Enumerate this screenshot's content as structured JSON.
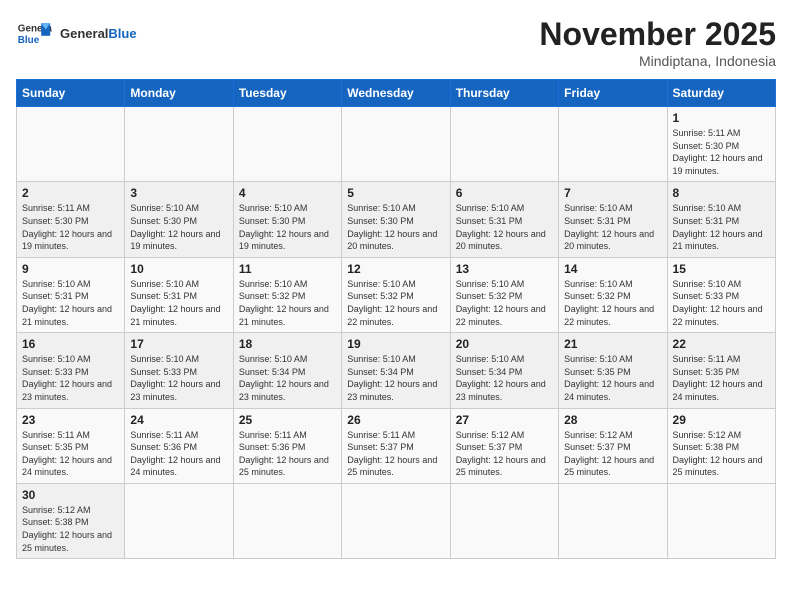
{
  "header": {
    "logo_text_general": "General",
    "logo_text_blue": "Blue",
    "title": "November 2025",
    "subtitle": "Mindiptana, Indonesia"
  },
  "weekdays": [
    "Sunday",
    "Monday",
    "Tuesday",
    "Wednesday",
    "Thursday",
    "Friday",
    "Saturday"
  ],
  "rows": [
    [
      {
        "day": "",
        "info": ""
      },
      {
        "day": "",
        "info": ""
      },
      {
        "day": "",
        "info": ""
      },
      {
        "day": "",
        "info": ""
      },
      {
        "day": "",
        "info": ""
      },
      {
        "day": "",
        "info": ""
      },
      {
        "day": "1",
        "info": "Sunrise: 5:11 AM\nSunset: 5:30 PM\nDaylight: 12 hours and 19 minutes."
      }
    ],
    [
      {
        "day": "2",
        "info": "Sunrise: 5:11 AM\nSunset: 5:30 PM\nDaylight: 12 hours and 19 minutes."
      },
      {
        "day": "3",
        "info": "Sunrise: 5:10 AM\nSunset: 5:30 PM\nDaylight: 12 hours and 19 minutes."
      },
      {
        "day": "4",
        "info": "Sunrise: 5:10 AM\nSunset: 5:30 PM\nDaylight: 12 hours and 19 minutes."
      },
      {
        "day": "5",
        "info": "Sunrise: 5:10 AM\nSunset: 5:30 PM\nDaylight: 12 hours and 20 minutes."
      },
      {
        "day": "6",
        "info": "Sunrise: 5:10 AM\nSunset: 5:31 PM\nDaylight: 12 hours and 20 minutes."
      },
      {
        "day": "7",
        "info": "Sunrise: 5:10 AM\nSunset: 5:31 PM\nDaylight: 12 hours and 20 minutes."
      },
      {
        "day": "8",
        "info": "Sunrise: 5:10 AM\nSunset: 5:31 PM\nDaylight: 12 hours and 21 minutes."
      }
    ],
    [
      {
        "day": "9",
        "info": "Sunrise: 5:10 AM\nSunset: 5:31 PM\nDaylight: 12 hours and 21 minutes."
      },
      {
        "day": "10",
        "info": "Sunrise: 5:10 AM\nSunset: 5:31 PM\nDaylight: 12 hours and 21 minutes."
      },
      {
        "day": "11",
        "info": "Sunrise: 5:10 AM\nSunset: 5:32 PM\nDaylight: 12 hours and 21 minutes."
      },
      {
        "day": "12",
        "info": "Sunrise: 5:10 AM\nSunset: 5:32 PM\nDaylight: 12 hours and 22 minutes."
      },
      {
        "day": "13",
        "info": "Sunrise: 5:10 AM\nSunset: 5:32 PM\nDaylight: 12 hours and 22 minutes."
      },
      {
        "day": "14",
        "info": "Sunrise: 5:10 AM\nSunset: 5:32 PM\nDaylight: 12 hours and 22 minutes."
      },
      {
        "day": "15",
        "info": "Sunrise: 5:10 AM\nSunset: 5:33 PM\nDaylight: 12 hours and 22 minutes."
      }
    ],
    [
      {
        "day": "16",
        "info": "Sunrise: 5:10 AM\nSunset: 5:33 PM\nDaylight: 12 hours and 23 minutes."
      },
      {
        "day": "17",
        "info": "Sunrise: 5:10 AM\nSunset: 5:33 PM\nDaylight: 12 hours and 23 minutes."
      },
      {
        "day": "18",
        "info": "Sunrise: 5:10 AM\nSunset: 5:34 PM\nDaylight: 12 hours and 23 minutes."
      },
      {
        "day": "19",
        "info": "Sunrise: 5:10 AM\nSunset: 5:34 PM\nDaylight: 12 hours and 23 minutes."
      },
      {
        "day": "20",
        "info": "Sunrise: 5:10 AM\nSunset: 5:34 PM\nDaylight: 12 hours and 23 minutes."
      },
      {
        "day": "21",
        "info": "Sunrise: 5:10 AM\nSunset: 5:35 PM\nDaylight: 12 hours and 24 minutes."
      },
      {
        "day": "22",
        "info": "Sunrise: 5:11 AM\nSunset: 5:35 PM\nDaylight: 12 hours and 24 minutes."
      }
    ],
    [
      {
        "day": "23",
        "info": "Sunrise: 5:11 AM\nSunset: 5:35 PM\nDaylight: 12 hours and 24 minutes."
      },
      {
        "day": "24",
        "info": "Sunrise: 5:11 AM\nSunset: 5:36 PM\nDaylight: 12 hours and 24 minutes."
      },
      {
        "day": "25",
        "info": "Sunrise: 5:11 AM\nSunset: 5:36 PM\nDaylight: 12 hours and 25 minutes."
      },
      {
        "day": "26",
        "info": "Sunrise: 5:11 AM\nSunset: 5:37 PM\nDaylight: 12 hours and 25 minutes."
      },
      {
        "day": "27",
        "info": "Sunrise: 5:12 AM\nSunset: 5:37 PM\nDaylight: 12 hours and 25 minutes."
      },
      {
        "day": "28",
        "info": "Sunrise: 5:12 AM\nSunset: 5:37 PM\nDaylight: 12 hours and 25 minutes."
      },
      {
        "day": "29",
        "info": "Sunrise: 5:12 AM\nSunset: 5:38 PM\nDaylight: 12 hours and 25 minutes."
      }
    ],
    [
      {
        "day": "30",
        "info": "Sunrise: 5:12 AM\nSunset: 5:38 PM\nDaylight: 12 hours and 25 minutes."
      },
      {
        "day": "",
        "info": ""
      },
      {
        "day": "",
        "info": ""
      },
      {
        "day": "",
        "info": ""
      },
      {
        "day": "",
        "info": ""
      },
      {
        "day": "",
        "info": ""
      },
      {
        "day": "",
        "info": ""
      }
    ]
  ]
}
